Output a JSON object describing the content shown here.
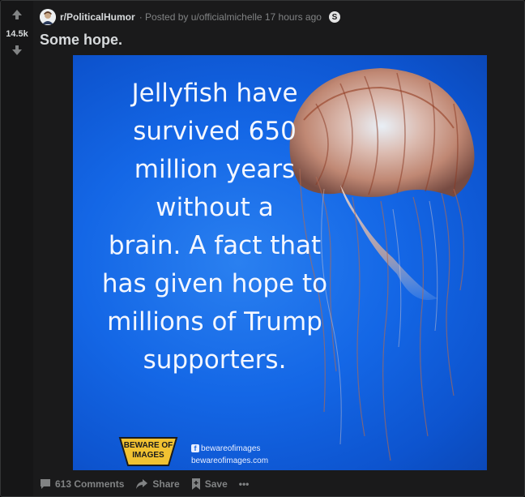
{
  "post": {
    "subreddit": "r/PoliticalHumor",
    "posted_by": "· Posted by u/officialmichelle 17 hours ago",
    "award_glyph": "S",
    "score": "14.5k",
    "title": "Some hope."
  },
  "image": {
    "text_lines": [
      "Jellyfish have",
      "survived 650",
      "million years",
      "without a",
      "brain. A fact that",
      "has given hope to",
      "millions of Trump",
      "supporters."
    ],
    "logo_line1": "BEWARE OF",
    "logo_line2": "IMAGES",
    "fb_glyph": "f",
    "social_handle": "bewareofimages",
    "website": "bewareofimages.com",
    "background_color": "#1467e6"
  },
  "actions": {
    "comments": "613 Comments",
    "share": "Share",
    "save": "Save",
    "more": "•••"
  },
  "colors": {
    "text": "#d7dadc",
    "meta": "#818384",
    "card": "#1a1a1b"
  }
}
